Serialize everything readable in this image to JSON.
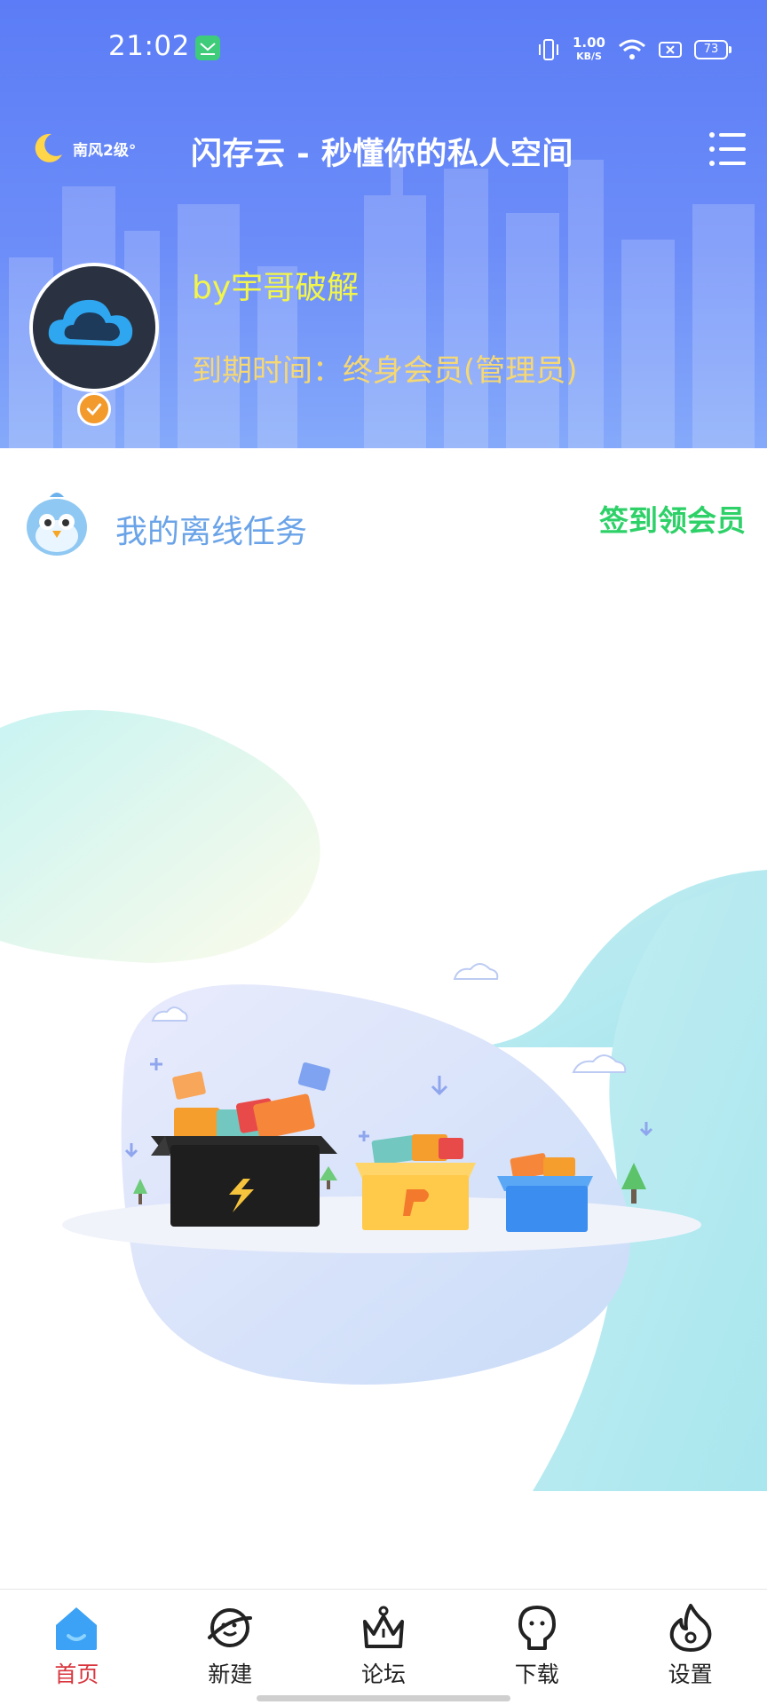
{
  "status_bar": {
    "time": "21:02",
    "speed_value": "1.00",
    "speed_unit": "KB/S",
    "battery": "73"
  },
  "header": {
    "weather": "南风2级°",
    "title": "闪存云 - 秒懂你的私人空间",
    "username": "by宇哥破解",
    "expire": "到期时间：终身会员(管理员)"
  },
  "task_section": {
    "title": "我的离线任务",
    "signin_label": "签到领会员"
  },
  "nav": {
    "items": [
      {
        "label": "首页",
        "icon": "home-icon",
        "active": true
      },
      {
        "label": "新建",
        "icon": "planet-icon",
        "active": false
      },
      {
        "label": "论坛",
        "icon": "crown-icon",
        "active": false
      },
      {
        "label": "下载",
        "icon": "lightbulb-icon",
        "active": false
      },
      {
        "label": "设置",
        "icon": "flame-icon",
        "active": false
      }
    ]
  },
  "colors": {
    "header_top": "#5B7CF6",
    "username": "#F2F54A",
    "expire": "#F5D773",
    "signin": "#2DD168",
    "task_title": "#6AA3E8",
    "nav_active": "#D9363E"
  }
}
